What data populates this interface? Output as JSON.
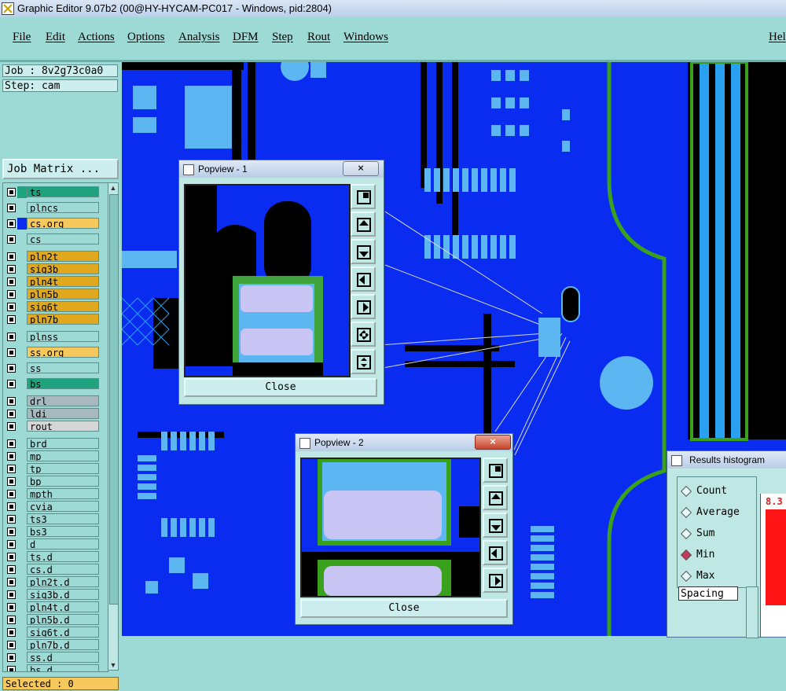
{
  "window": {
    "title": "Graphic Editor 9.07b2 (00@HY-HYCAM-PC017 - Windows, pid:2804)"
  },
  "menu": {
    "items": [
      "File",
      "Edit",
      "Actions",
      "Options",
      "Analysis",
      "DFM",
      "Step",
      "Rout",
      "Windows"
    ],
    "help": "Hel"
  },
  "job": {
    "job_label": "Job : 8v2g73c0a0",
    "step_label": "Step: cam",
    "matrix_button": "Job Matrix ..."
  },
  "layers": [
    {
      "name": "ts",
      "color": "#1fa37e",
      "swatch": "#1fa37e"
    },
    {
      "name": "plncs",
      "color": "#9ddad6",
      "swatch": ""
    },
    {
      "name": "cs.org",
      "color": "#f7c95c",
      "swatch": "#0a2cf0"
    },
    {
      "name": "cs",
      "color": "#9ddad6",
      "swatch": ""
    },
    {
      "name": "pln2t",
      "color": "#e0a81e",
      "swatch": ""
    },
    {
      "name": "sig3b",
      "color": "#e0a81e",
      "swatch": ""
    },
    {
      "name": "pln4t",
      "color": "#e0a81e",
      "swatch": ""
    },
    {
      "name": "pln5b",
      "color": "#e0a81e",
      "swatch": ""
    },
    {
      "name": "sig6t",
      "color": "#e0a81e",
      "swatch": ""
    },
    {
      "name": "pln7b",
      "color": "#e0a81e",
      "swatch": ""
    },
    {
      "name": "plnss",
      "color": "#9ddad6",
      "swatch": ""
    },
    {
      "name": "ss.org",
      "color": "#f7c95c",
      "swatch": ""
    },
    {
      "name": "ss",
      "color": "#9ddad6",
      "swatch": ""
    },
    {
      "name": "bs",
      "color": "#1fa37e",
      "swatch": ""
    },
    {
      "name": "drl",
      "color": "#a8b8bf",
      "swatch": ""
    },
    {
      "name": "ldi",
      "color": "#a8b8bf",
      "swatch": ""
    },
    {
      "name": "rout",
      "color": "#d6d6d6",
      "swatch": ""
    },
    {
      "name": "brd",
      "color": "#9ddad6",
      "swatch": ""
    },
    {
      "name": "mp",
      "color": "#9ddad6",
      "swatch": ""
    },
    {
      "name": "tp",
      "color": "#9ddad6",
      "swatch": ""
    },
    {
      "name": "bp",
      "color": "#9ddad6",
      "swatch": ""
    },
    {
      "name": "mpth",
      "color": "#9ddad6",
      "swatch": ""
    },
    {
      "name": "cvia",
      "color": "#9ddad6",
      "swatch": ""
    },
    {
      "name": "ts3",
      "color": "#9ddad6",
      "swatch": ""
    },
    {
      "name": "bs3",
      "color": "#9ddad6",
      "swatch": ""
    },
    {
      "name": "d",
      "color": "#9ddad6",
      "swatch": ""
    },
    {
      "name": "ts.d",
      "color": "#9ddad6",
      "swatch": ""
    },
    {
      "name": "cs.d",
      "color": "#9ddad6",
      "swatch": ""
    },
    {
      "name": "pln2t.d",
      "color": "#9ddad6",
      "swatch": ""
    },
    {
      "name": "sig3b.d",
      "color": "#9ddad6",
      "swatch": ""
    },
    {
      "name": "pln4t.d",
      "color": "#9ddad6",
      "swatch": ""
    },
    {
      "name": "pln5b.d",
      "color": "#9ddad6",
      "swatch": ""
    },
    {
      "name": "sig6t.d",
      "color": "#9ddad6",
      "swatch": ""
    },
    {
      "name": "pln7b.d",
      "color": "#9ddad6",
      "swatch": ""
    },
    {
      "name": "ss.d",
      "color": "#9ddad6",
      "swatch": ""
    },
    {
      "name": "bs.d",
      "color": "#9ddad6",
      "swatch": ""
    }
  ],
  "status": {
    "selected": "Selected : 0"
  },
  "popview1": {
    "title": "Popview - 1",
    "close_x": "×",
    "close_button": "Close"
  },
  "popview2": {
    "title": "Popview - 2",
    "close_x": "×",
    "close_button": "Close"
  },
  "results": {
    "title": "Results histogram",
    "options": [
      "Count",
      "Average",
      "Sum",
      "Min",
      "Max"
    ],
    "selected_option": "Min",
    "spacing": "Spacing",
    "value_label": "8.3"
  }
}
